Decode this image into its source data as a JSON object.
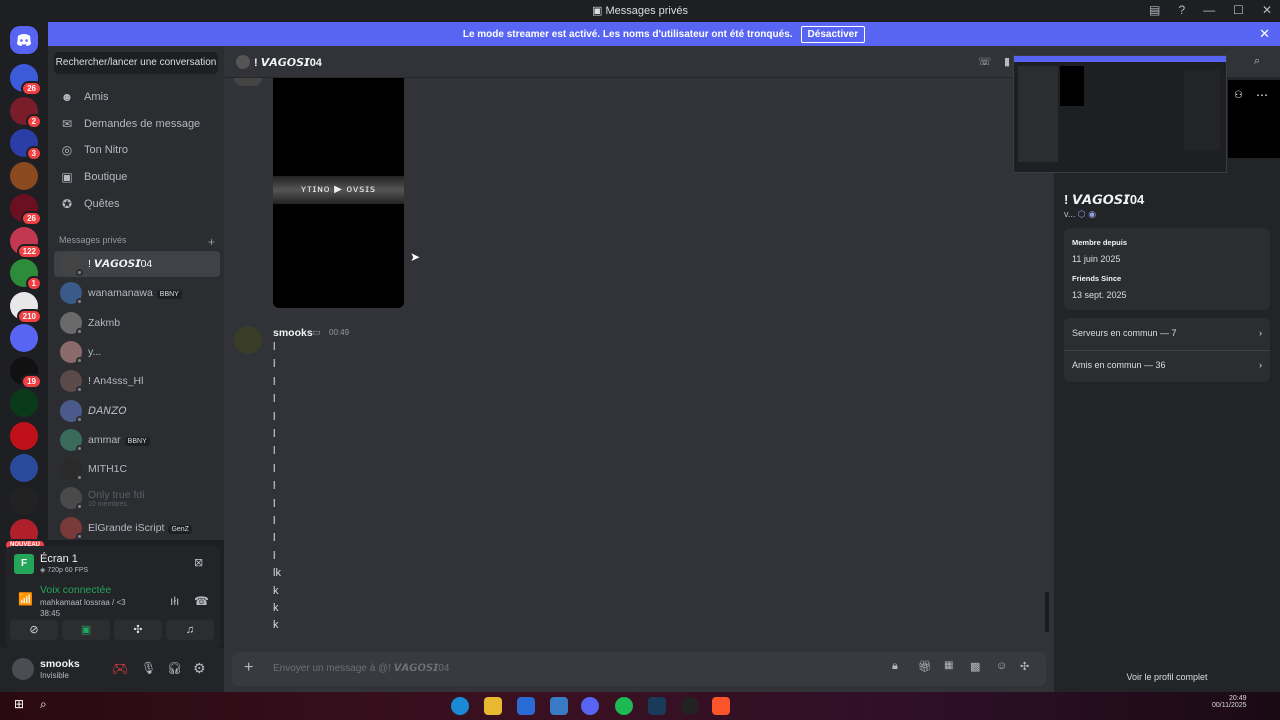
{
  "window": {
    "title": "Messages privés"
  },
  "banner": {
    "text": "Le mode streamer est activé. Les noms d'utilisateur ont été tronqués.",
    "disable_label": "Désactiver"
  },
  "servers": [
    {
      "badge": "26",
      "color": "#3b5bdb"
    },
    {
      "badge": "2",
      "color": "#7a1d2a"
    },
    {
      "badge": "3",
      "color": "#2b3ea8"
    },
    {
      "badge": "",
      "color": "#8a4a20"
    },
    {
      "badge": "26",
      "color": "#6a1020"
    },
    {
      "badge": "122",
      "color": "#c23850"
    },
    {
      "badge": "1",
      "color": "#2e8b3a"
    },
    {
      "badge": "210",
      "color": "#e8e8e8"
    },
    {
      "badge": "",
      "color": "#5865f2"
    },
    {
      "badge": "19",
      "color": "#111111"
    },
    {
      "badge": "",
      "color": "#0a3a1a"
    },
    {
      "badge": "",
      "color": "#c0101a"
    },
    {
      "badge": "",
      "color": "#2a4a9a"
    },
    {
      "badge": "",
      "color": "#222222"
    },
    {
      "badge": "NOUVEAU",
      "color": "#b0202a"
    }
  ],
  "dm": {
    "search_label": "Rechercher/lancer une conversation",
    "nav": [
      {
        "label": "Amis",
        "icon": "friends-icon"
      },
      {
        "label": "Demandes de message",
        "icon": "mail-icon"
      },
      {
        "label": "Ton Nitro",
        "icon": "nitro-icon"
      },
      {
        "label": "Boutique",
        "icon": "shop-icon"
      },
      {
        "label": "Quêtes",
        "icon": "quests-icon"
      }
    ],
    "header": "Messages privés",
    "add": "+",
    "conversations": [
      {
        "name": "! 𝙑𝘼𝙂𝙊𝙎𝙄04",
        "tag": "",
        "sub": "",
        "active": true,
        "color": "#444"
      },
      {
        "name": "wanamanawa",
        "tag": "BBNY",
        "sub": "",
        "active": false,
        "color": "#3a5a8a"
      },
      {
        "name": "Zakmb",
        "tag": "",
        "sub": "",
        "active": false,
        "color": "#6a6a6a"
      },
      {
        "name": "y...",
        "tag": "",
        "sub": "",
        "active": false,
        "color": "#8a6a6a"
      },
      {
        "name": "! An4sss_Hl",
        "tag": "",
        "sub": "",
        "active": false,
        "color": "#5a4a4a"
      },
      {
        "name": "𝘋𝘈𝘕𝘡𝘖",
        "tag": "",
        "sub": "",
        "active": false,
        "color": "#4a5a8a"
      },
      {
        "name": "ammar",
        "tag": "BBNY",
        "sub": "",
        "active": false,
        "color": "#3a6a5a"
      },
      {
        "name": "MITH1C",
        "tag": "",
        "sub": "",
        "active": false,
        "color": "#2a2a2a"
      },
      {
        "name": "Only true fdi",
        "tag": "",
        "sub": "10 membres",
        "active": false,
        "color": "#4a4a4a"
      },
      {
        "name": "ElGrande iScript",
        "tag": "GenZ",
        "sub": "",
        "active": false,
        "color": "#7a3a3a"
      }
    ]
  },
  "voice": {
    "screen_title": "Écran 1",
    "screen_quality": "720p 60 FPS",
    "status": "Voix connectée",
    "channel": "mahkamaat lossraa / <3",
    "timer": "38:45"
  },
  "user": {
    "name": "smooks",
    "status": "Invisible"
  },
  "chat": {
    "recipient": "! 𝙑𝘼𝙂𝙊𝙎𝙄04",
    "video_overlay_text": "ʏᴛɪɴᴏ  ▶  ᴏᴠꜱɪꜱ",
    "message_author": "smooks",
    "message_time": "00:49",
    "message_lines": [
      "l",
      "l",
      "l",
      "l",
      "l",
      "l",
      "l",
      "l",
      "l",
      "l",
      "l",
      "l",
      "l",
      "lk",
      "k",
      "k",
      "k"
    ],
    "composer_placeholder": "Envoyer un message à @! 𝙑𝘼𝙂𝙊𝙎𝙄04"
  },
  "profile": {
    "name": "! 𝙑𝘼𝙂𝙊𝙎𝙄04",
    "short": "v...",
    "member_since_label": "Membre depuis",
    "member_since": "11 juin 2025",
    "friends_since_label": "Friends Since",
    "friends_since": "13 sept. 2025",
    "common_servers": "Serveurs en commun — 7",
    "common_friends": "Amis en commun — 36",
    "full_profile": "Voir le profil complet"
  },
  "taskbar": {
    "time": "20:49",
    "date": "00/11/2025"
  },
  "colors": {
    "accent": "#5865f2",
    "danger": "#f23f43",
    "green": "#23a55a"
  }
}
